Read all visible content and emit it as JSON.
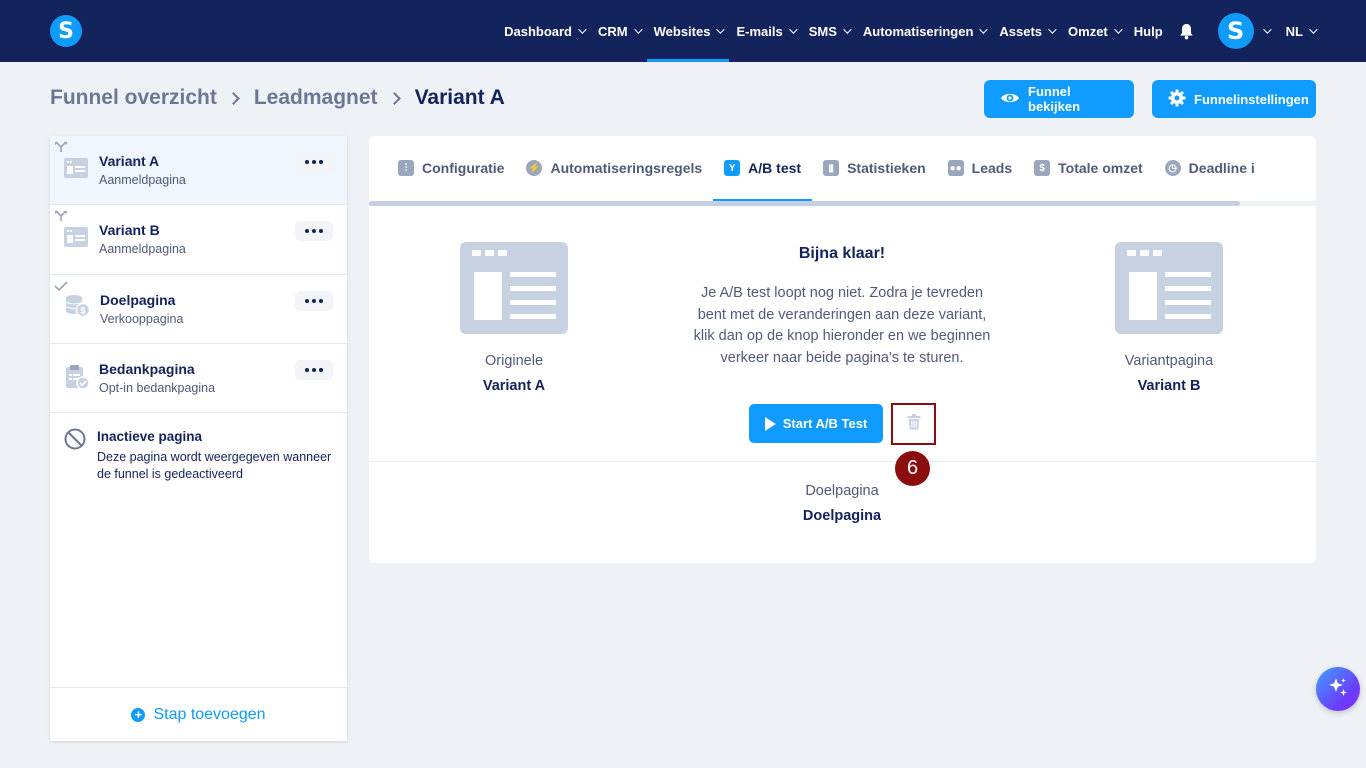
{
  "app": {
    "logo_letter": "S"
  },
  "nav": {
    "items": [
      {
        "label": "Dashboard",
        "has_dropdown": true
      },
      {
        "label": "CRM",
        "has_dropdown": true
      },
      {
        "label": "Websites",
        "has_dropdown": true,
        "active": true
      },
      {
        "label": "E-mails",
        "has_dropdown": true
      },
      {
        "label": "SMS",
        "has_dropdown": true
      },
      {
        "label": "Automatiseringen",
        "has_dropdown": true
      },
      {
        "label": "Assets",
        "has_dropdown": true
      },
      {
        "label": "Omzet",
        "has_dropdown": true
      },
      {
        "label": "Hulp",
        "has_dropdown": false
      }
    ],
    "avatar_letter": "S",
    "language": "NL",
    "accent_color": "#0f9bff",
    "bg_color": "#13235b"
  },
  "breadcrumb": {
    "items": [
      "Funnel overzicht",
      "Leadmagnet"
    ],
    "current": "Variant A"
  },
  "header_buttons": {
    "view_funnel": "Funnel bekijken",
    "funnel_settings": "Funnelinstellingen"
  },
  "sidebar": {
    "steps": [
      {
        "title": "Variant A",
        "subtitle": "Aanmeldpagina",
        "icon": "landing-page-icon",
        "marker": "split-icon",
        "selected": true
      },
      {
        "title": "Variant B",
        "subtitle": "Aanmeldpagina",
        "icon": "landing-page-icon",
        "marker": "split-icon"
      },
      {
        "title": "Doelpagina",
        "subtitle": "Verkooppagina",
        "icon": "coins-icon",
        "marker": "check-icon"
      },
      {
        "title": "Bedankpagina",
        "subtitle": "Opt-in bedankpagina",
        "icon": "clipboard-check-icon"
      }
    ],
    "inactive": {
      "title": "Inactieve pagina",
      "description": "Deze pagina wordt weergegeven wanneer de funnel is gedeactiveerd"
    },
    "add_step": "Stap toevoegen"
  },
  "tabs": [
    {
      "label": "Configuratie",
      "icon": "sliders-icon"
    },
    {
      "label": "Automatiseringsregels",
      "icon": "lightning-icon"
    },
    {
      "label": "A/B test",
      "icon": "split-icon",
      "active": true
    },
    {
      "label": "Statistieken",
      "icon": "chart-icon"
    },
    {
      "label": "Leads",
      "icon": "users-icon"
    },
    {
      "label": "Totale omzet",
      "icon": "dollar-icon"
    },
    {
      "label": "Deadline i",
      "icon": "clock-icon"
    }
  ],
  "ab_test": {
    "original_label": "Originele",
    "original_name": "Variant A",
    "variant_label": "Variantpagina",
    "variant_name": "Variant B",
    "title": "Bijna klaar!",
    "description": "Je A/B test loopt nog niet. Zodra je tevreden bent met de veranderingen aan deze variant, klik dan op de knop hieronder en we beginnen verkeer naar beide pagina's te sturen.",
    "start_button": "Start A/B Test",
    "target_label": "Doelpagina",
    "target_name": "Doelpagina"
  },
  "annotation": {
    "number": "6",
    "color": "#8b0d0d"
  }
}
